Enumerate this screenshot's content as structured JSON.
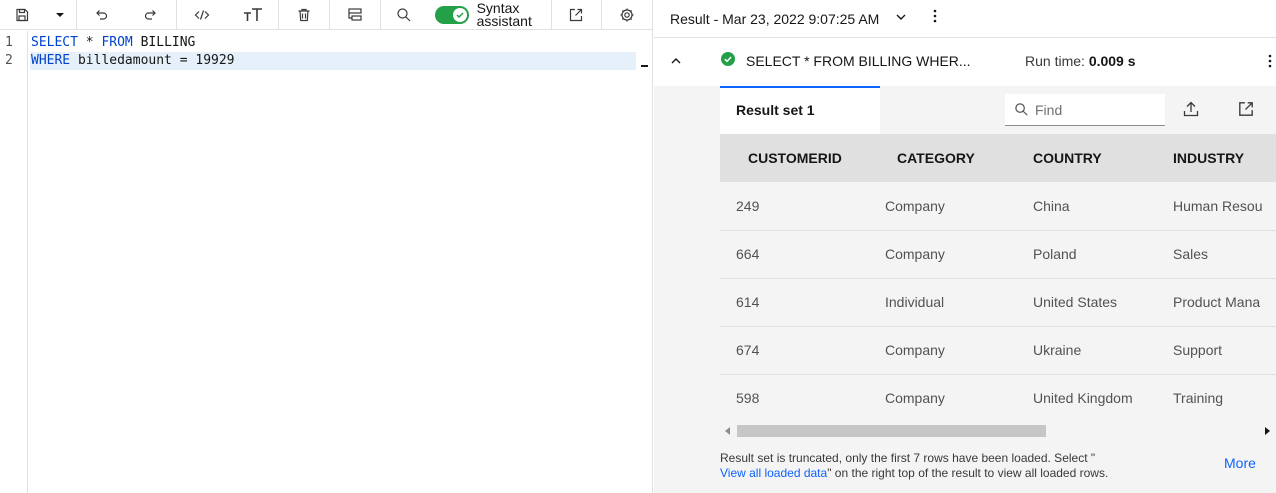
{
  "toolbar": {
    "syntax_assistant_label": "Syntax assistant",
    "syntax_assistant_on": true
  },
  "editor": {
    "lines": [
      {
        "number": "1",
        "keyword1": "SELECT",
        "rest1": " * ",
        "keyword2": "FROM",
        "rest2": " BILLING"
      },
      {
        "number": "2",
        "keyword1": "WHERE",
        "rest1": " billedamount = 19929"
      }
    ]
  },
  "result": {
    "title": "Result - Mar 23, 2022 9:07:25 AM",
    "query_summary": "SELECT * FROM BILLING WHER...",
    "runtime_label": "Run time:",
    "runtime_value": "0.009 s",
    "status": "success",
    "tab_label": "Result set 1",
    "find_placeholder": "Find",
    "columns": [
      "CUSTOMERID",
      "CATEGORY",
      "COUNTRY",
      "INDUSTRY"
    ],
    "rows": [
      [
        "249",
        "Company",
        "China",
        "Human Resou"
      ],
      [
        "664",
        "Company",
        "Poland",
        "Sales"
      ],
      [
        "614",
        "Individual",
        "United States",
        "Product Mana"
      ],
      [
        "674",
        "Company",
        "Ukraine",
        "Support"
      ],
      [
        "598",
        "Company",
        "United Kingdom",
        "Training"
      ]
    ],
    "truncation_note_before": "Result set is truncated, only the first 7 rows have been loaded. Select \"",
    "truncation_link": "View all loaded data",
    "truncation_note_after": "\" on the right top of the result to view all loaded rows.",
    "more_label": "More"
  },
  "colors": {
    "accent": "#0f62fe",
    "success": "#24a148",
    "keyword": "#0043ce",
    "active_line": "#e5f0fa"
  }
}
